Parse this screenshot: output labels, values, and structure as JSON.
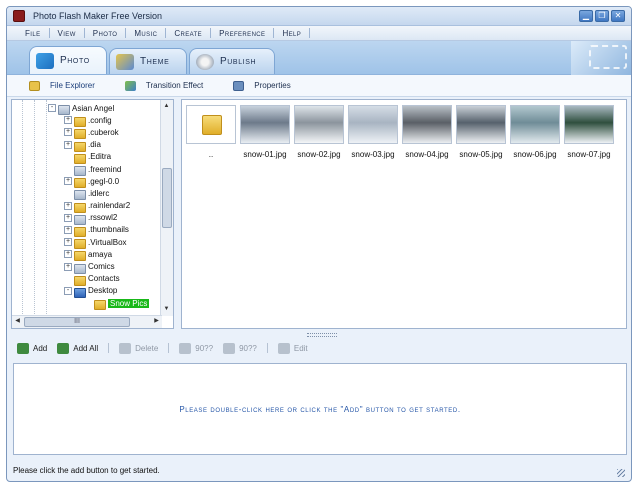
{
  "window": {
    "title": "Photo Flash Maker Free Version",
    "controls": [
      "minimize",
      "restore",
      "close"
    ]
  },
  "menu": [
    "File",
    "View",
    "Photo",
    "Music",
    "Create",
    "Preference",
    "Help"
  ],
  "main_tabs": [
    {
      "label": "Photo",
      "icon": "photo-icon",
      "active": true
    },
    {
      "label": "Theme",
      "icon": "theme-icon",
      "active": false
    },
    {
      "label": "Publish",
      "icon": "publish-icon",
      "active": false
    }
  ],
  "sub_tabs": [
    {
      "label": "File Explorer",
      "icon": "folder-icon",
      "active": true
    },
    {
      "label": "Transition Effect",
      "icon": "transition-icon",
      "active": false
    },
    {
      "label": "Properties",
      "icon": "properties-icon",
      "active": false
    }
  ],
  "tree": {
    "items": [
      {
        "label": "Asian Angel",
        "expander": "-",
        "folder": "grey",
        "level": 0
      },
      {
        "label": ".config",
        "expander": "+",
        "folder": "yellow",
        "level": 1
      },
      {
        "label": ".cuberok",
        "expander": "+",
        "folder": "yellow",
        "level": 1
      },
      {
        "label": ".dia",
        "expander": "+",
        "folder": "yellow",
        "level": 1
      },
      {
        "label": ".Editra",
        "expander": "",
        "folder": "yellow",
        "level": 1
      },
      {
        "label": ".freemind",
        "expander": "",
        "folder": "grey",
        "level": 1
      },
      {
        "label": ".gegl-0.0",
        "expander": "+",
        "folder": "yellow",
        "level": 1
      },
      {
        "label": ".idlerc",
        "expander": "",
        "folder": "grey",
        "level": 1
      },
      {
        "label": ".rainlendar2",
        "expander": "+",
        "folder": "yellow",
        "level": 1
      },
      {
        "label": ".rssowl2",
        "expander": "+",
        "folder": "grey",
        "level": 1
      },
      {
        "label": ".thumbnails",
        "expander": "+",
        "folder": "yellow",
        "level": 1
      },
      {
        "label": ".VirtualBox",
        "expander": "+",
        "folder": "yellow",
        "level": 1
      },
      {
        "label": "amaya",
        "expander": "+",
        "folder": "yellow",
        "level": 1
      },
      {
        "label": "Comics",
        "expander": "+",
        "folder": "grey",
        "level": 1
      },
      {
        "label": "Contacts",
        "expander": "",
        "folder": "yellow",
        "level": 1
      },
      {
        "label": "Desktop",
        "expander": "-",
        "folder": "desk",
        "level": 1
      },
      {
        "label": "Snow Pics",
        "expander": "",
        "folder": "yellow",
        "level": 2,
        "selected": true
      }
    ],
    "hscroll_label": "III"
  },
  "thumbnails": [
    {
      "caption": "..",
      "kind": "folder"
    },
    {
      "caption": "snow-01.jpg",
      "kind": "image",
      "colors": [
        "#6d7a8a",
        "#c8d2dd",
        "#e9eef3"
      ]
    },
    {
      "caption": "snow-02.jpg",
      "kind": "image",
      "colors": [
        "#8b949d",
        "#dfe5ea",
        "#f4f6f8"
      ]
    },
    {
      "caption": "snow-03.jpg",
      "kind": "image",
      "colors": [
        "#a8b4c2",
        "#d5dde6",
        "#eef2f6"
      ]
    },
    {
      "caption": "snow-04.jpg",
      "kind": "image",
      "colors": [
        "#5a5f66",
        "#b9c0c7",
        "#eceff2"
      ]
    },
    {
      "caption": "snow-05.jpg",
      "kind": "image",
      "colors": [
        "#56616c",
        "#c9d0d7",
        "#eef1f4"
      ]
    },
    {
      "caption": "snow-06.jpg",
      "kind": "image",
      "colors": [
        "#6f8c97",
        "#b3c8cf",
        "#e2eaee"
      ]
    },
    {
      "caption": "snow-07.jpg",
      "kind": "image",
      "colors": [
        "#2f4f3e",
        "#a9b9c2",
        "#eef2f5"
      ]
    }
  ],
  "toolbar": [
    {
      "label": "Add",
      "icon": "add-icon",
      "enabled": true
    },
    {
      "label": "Add All",
      "icon": "add-all-icon",
      "enabled": true
    },
    {
      "label": "Delete",
      "icon": "delete-icon",
      "enabled": false
    },
    {
      "label": "90??",
      "icon": "rotate-left-icon",
      "enabled": false
    },
    {
      "label": "90??",
      "icon": "rotate-right-icon",
      "enabled": false
    },
    {
      "label": "Edit",
      "icon": "edit-icon",
      "enabled": false
    }
  ],
  "drop_area": {
    "message": "Please double-click here or click the \"Add\" button to get started."
  },
  "status": {
    "text": "Please click the add button to get started."
  },
  "colors": {
    "accent": "#2757a8",
    "selection": "#19b819",
    "frame": "#7b97bd"
  }
}
